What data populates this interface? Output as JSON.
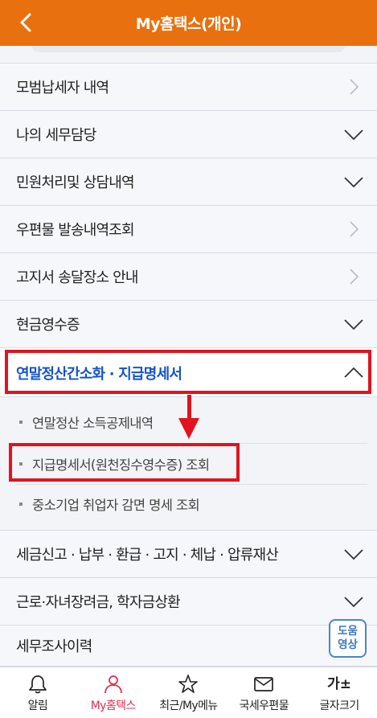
{
  "header": {
    "title": "My홈택스(개인)"
  },
  "menu_top": [
    {
      "label": "모범납세자 내역",
      "icon": "chevron-right"
    },
    {
      "label": "나의 세무담당",
      "icon": "chevron-down"
    },
    {
      "label": "민원처리및 상담내역",
      "icon": "chevron-down"
    },
    {
      "label": "우편물 발송내역조회",
      "icon": "chevron-right"
    },
    {
      "label": "고지서 송달장소 안내",
      "icon": "chevron-right"
    },
    {
      "label": "현금영수증",
      "icon": "chevron-down"
    }
  ],
  "active_section": {
    "label": "연말정산간소화 · 지급명세서",
    "icon": "chevron-up"
  },
  "submenu": [
    {
      "label": "연말정산 소득공제내역"
    },
    {
      "label": "지급명세서(원천징수영수증) 조회"
    },
    {
      "label": "중소기업 취업자 감면 명세 조회"
    }
  ],
  "menu_bottom": [
    {
      "label": "세금신고 · 납부 · 환급 · 고지 · 체납 · 압류재산",
      "icon": "chevron-down"
    },
    {
      "label": "근로·자녀장려금, 학자금상환",
      "icon": "chevron-down"
    },
    {
      "label": "세무조사이력",
      "icon": "none"
    }
  ],
  "help_button": {
    "line1": "도움",
    "line2": "영상"
  },
  "bottom_nav": [
    {
      "label": "알림",
      "icon": "bell-icon"
    },
    {
      "label": "My홈택스",
      "icon": "person-icon"
    },
    {
      "label": "최근/My메뉴",
      "icon": "star-icon"
    },
    {
      "label": "국세우편물",
      "icon": "envelope-icon"
    },
    {
      "label": "글자크기",
      "icon_text": "가±"
    }
  ],
  "colors": {
    "header": "#e8700f",
    "active_text": "#1654c8",
    "highlight": "#e0141e",
    "nav_active": "#e0314e"
  }
}
